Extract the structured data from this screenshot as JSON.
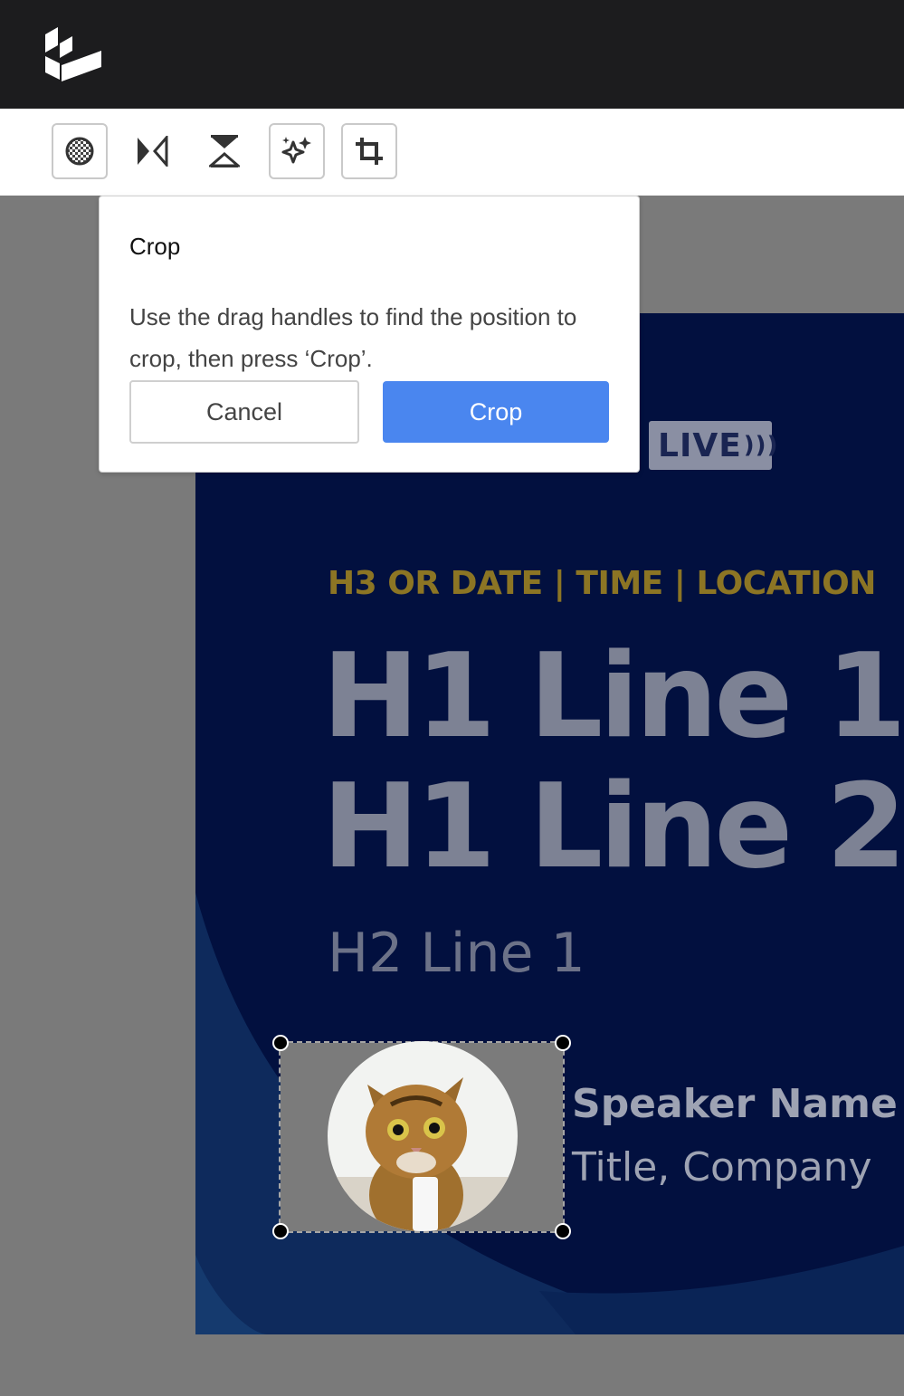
{
  "app": {
    "logo_icon": "app-logo-icon"
  },
  "toolbar": {
    "tools": [
      {
        "name": "transparency-tool",
        "icon": "checker-circle-icon",
        "boxed": true
      },
      {
        "name": "flip-horizontal-tool",
        "icon": "flip-horizontal-icon",
        "boxed": false
      },
      {
        "name": "flip-vertical-tool",
        "icon": "flip-vertical-icon",
        "boxed": false
      },
      {
        "name": "magic-tool",
        "icon": "sparkles-icon",
        "boxed": true
      },
      {
        "name": "crop-tool",
        "icon": "crop-icon",
        "boxed": true
      }
    ]
  },
  "popup": {
    "title": "Crop",
    "body": "Use the drag handles to find the position to crop, then press ‘Crop’.",
    "cancel_label": "Cancel",
    "crop_label": "Crop"
  },
  "design": {
    "live_badge": "LIVE",
    "h3": "H3 OR DATE | TIME | LOCATION",
    "h1_line1": "H1 Line 1",
    "h1_line2": "H1 Line 2",
    "h2_line1": "H2 Line 1",
    "speaker_name": "Speaker Name",
    "speaker_title": "Title, Company"
  },
  "colors": {
    "topbar": "#1c1c1e",
    "canvas_bg": "#02103f",
    "accent_gold": "#8c7524",
    "primary_button": "#4a86ef"
  }
}
